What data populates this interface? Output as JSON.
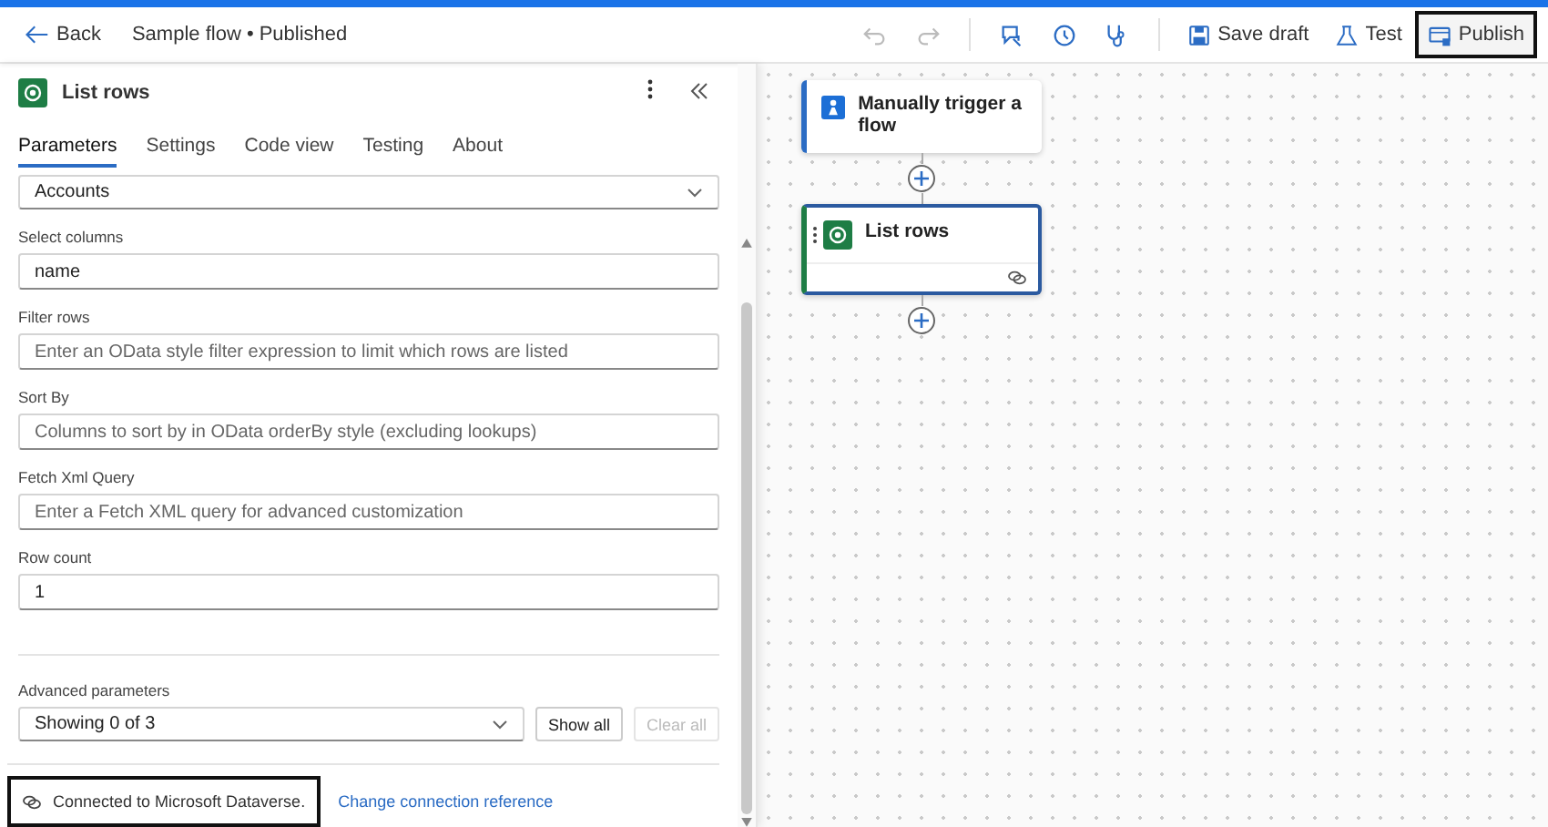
{
  "header": {
    "back": "Back",
    "title": "Sample flow • Published",
    "tools": [
      {
        "kind": "undo",
        "disabled": true
      },
      {
        "kind": "redo",
        "disabled": true
      },
      {
        "kind": "assistant",
        "disabled": false
      },
      {
        "kind": "history",
        "disabled": false
      },
      {
        "kind": "checker",
        "disabled": false
      }
    ],
    "actions": [
      {
        "kind": "save",
        "label": "Save draft",
        "highlighted": false
      },
      {
        "kind": "test",
        "label": "Test",
        "highlighted": false
      },
      {
        "kind": "publish",
        "label": "Publish",
        "highlighted": true
      }
    ]
  },
  "panel": {
    "title": "List rows",
    "tabs": [
      {
        "label": "Parameters",
        "selected": true
      },
      {
        "label": "Settings",
        "selected": false
      },
      {
        "label": "Code view",
        "selected": false
      },
      {
        "label": "Testing",
        "selected": false
      },
      {
        "label": "About",
        "selected": false
      }
    ],
    "fields": [
      {
        "kind": "select",
        "value": "Accounts"
      },
      {
        "kind": "text",
        "label": "Select columns",
        "value": "name"
      },
      {
        "kind": "text",
        "label": "Filter rows",
        "placeholder": "Enter an OData style filter expression to limit which rows are listed"
      },
      {
        "kind": "text",
        "label": "Sort By",
        "placeholder": "Columns to sort by in OData orderBy style (excluding lookups)"
      },
      {
        "kind": "text",
        "label": "Fetch Xml Query",
        "placeholder": "Enter a Fetch XML query for advanced customization"
      },
      {
        "kind": "text",
        "label": "Row count",
        "value": "1"
      }
    ],
    "advanced": {
      "label": "Advanced parameters",
      "value": "Showing 0 of 3",
      "buttons": [
        {
          "label": "Show all",
          "disabled": false
        },
        {
          "label": "Clear all",
          "disabled": true
        }
      ]
    },
    "connection": {
      "text": "Connected to Microsoft Dataverse.",
      "highlighted": true,
      "link": "Change connection reference"
    }
  },
  "canvas": {
    "nodes": [
      {
        "kind": "trigger",
        "title": "Manually trigger a flow",
        "selected": false
      },
      {
        "kind": "dataverse",
        "title": "List rows",
        "selected": true
      }
    ]
  }
}
